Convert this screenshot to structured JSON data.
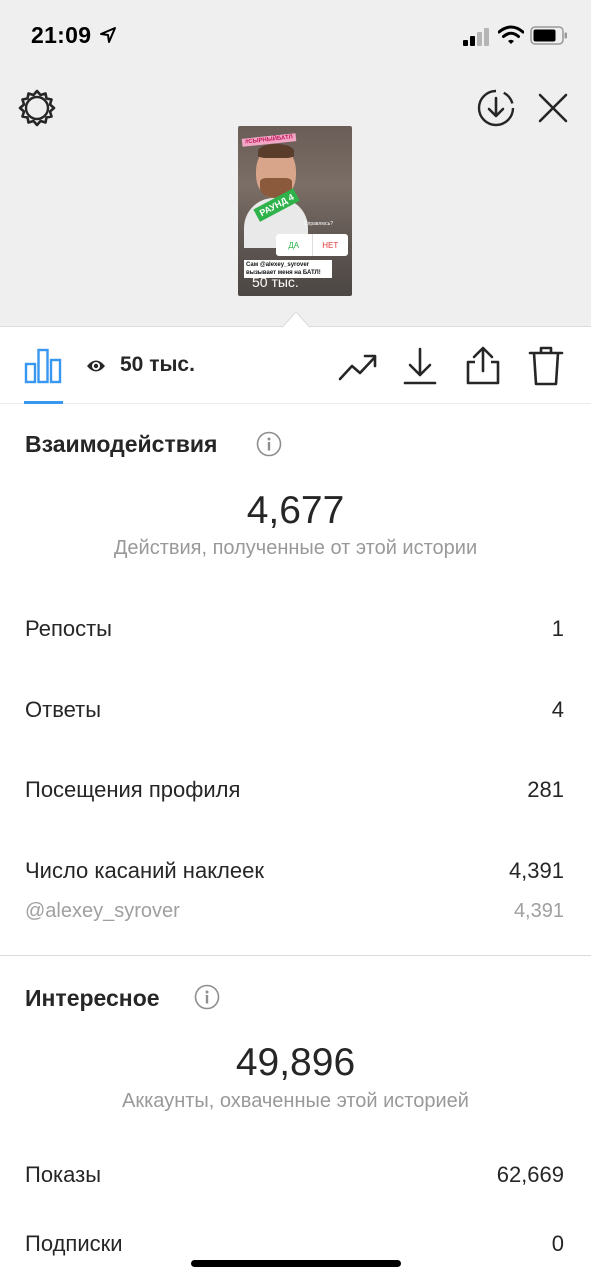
{
  "status": {
    "time": "21:09"
  },
  "story": {
    "tag": "#СЫРНЫЙБАТЛ",
    "round": "РАУНД 4",
    "question": "Справлюсь?",
    "poll_yes": "ДА",
    "poll_no": "НЕТ",
    "mention": "Сам @alexey_syrover вызывает меня на БАТЛ!",
    "views": "50 тыс."
  },
  "toolbar": {
    "views": "50 тыс."
  },
  "interactions": {
    "title": "Взаимодействия",
    "total": "4,677",
    "subtitle": "Действия, полученные от этой истории",
    "rows": [
      {
        "label": "Репосты",
        "value": "1"
      },
      {
        "label": "Ответы",
        "value": "4"
      },
      {
        "label": "Посещения профиля",
        "value": "281"
      },
      {
        "label": "Число касаний наклеек",
        "value": "4,391"
      }
    ],
    "sub_row": {
      "label": "@alexey_syrover",
      "value": "4,391"
    }
  },
  "discovery": {
    "title": "Интересное",
    "total": "49,896",
    "subtitle": "Аккаунты, охваченные этой историей",
    "rows": [
      {
        "label": "Показы",
        "value": "62,669"
      },
      {
        "label": "Подписки",
        "value": "0"
      }
    ]
  }
}
